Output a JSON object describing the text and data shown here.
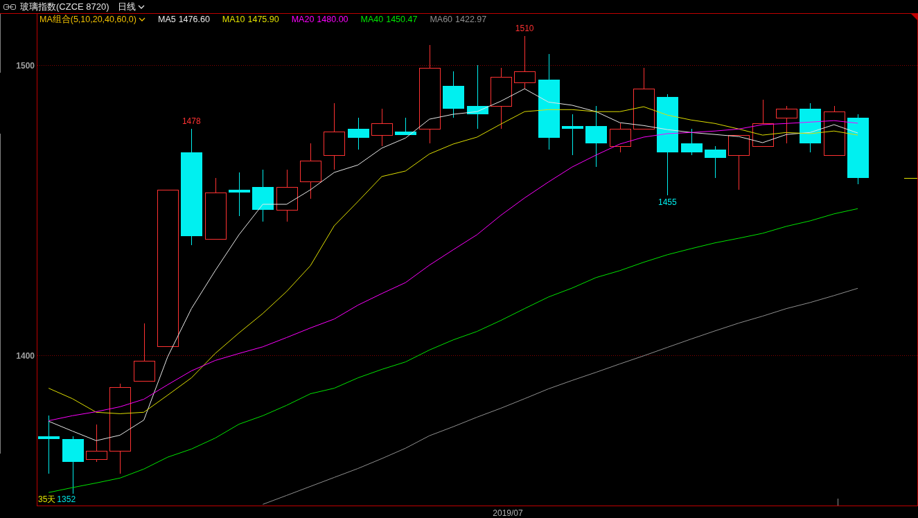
{
  "header": {
    "title": "玻璃指数(CZCE 8720)",
    "period": "日线"
  },
  "chart": {
    "legend": {
      "title": "MA组合(5,10,20,40,60,0)",
      "readings": [
        "1476.60",
        "1475.90",
        "1480.00",
        "1450.47",
        "1422.97"
      ]
    },
    "chart_data": {
      "type": "candlestick",
      "ylim": [
        1348,
        1518
      ],
      "yticks": [
        {
          "value": 1400,
          "label": "1400"
        },
        {
          "value": 1500,
          "label": "1500"
        }
      ],
      "ohlc": [
        [
          1372,
          1379,
          1359,
          1371
        ],
        [
          1371,
          1372,
          1352,
          1363
        ],
        [
          1364,
          1376,
          1363,
          1367
        ],
        [
          1367,
          1390,
          1359,
          1389
        ],
        [
          1391,
          1411,
          1391,
          1398
        ],
        [
          1403,
          1457,
          1403,
          1457
        ],
        [
          1470,
          1478,
          1438,
          1441
        ],
        [
          1440,
          1461,
          1440,
          1456
        ],
        [
          1457,
          1463,
          1448,
          1456
        ],
        [
          1458,
          1464,
          1446,
          1450
        ],
        [
          1450,
          1464,
          1446,
          1458
        ],
        [
          1460,
          1473,
          1454,
          1467
        ],
        [
          1469,
          1487,
          1464,
          1477
        ],
        [
          1478,
          1482,
          1471,
          1475
        ],
        [
          1476,
          1485,
          1472,
          1480
        ],
        [
          1477,
          1482,
          1476,
          1476
        ],
        [
          1478,
          1507,
          1473,
          1499
        ],
        [
          1493,
          1498,
          1482,
          1485
        ],
        [
          1486,
          1500,
          1478,
          1483
        ],
        [
          1486,
          1499,
          1478,
          1496
        ],
        [
          1494,
          1510,
          1492,
          1498
        ],
        [
          1495,
          1504,
          1471,
          1475
        ],
        [
          1479,
          1483,
          1469,
          1478
        ],
        [
          1479,
          1486,
          1465,
          1473
        ],
        [
          1472,
          1480,
          1470,
          1478
        ],
        [
          1478,
          1499,
          1478,
          1492
        ],
        [
          1489,
          1490,
          1455,
          1470
        ],
        [
          1473,
          1478,
          1469,
          1470
        ],
        [
          1471,
          1472,
          1461,
          1468
        ],
        [
          1469,
          1476,
          1457,
          1476
        ],
        [
          1472,
          1488,
          1472,
          1480
        ],
        [
          1482,
          1486,
          1473,
          1485
        ],
        [
          1485,
          1487,
          1470,
          1473
        ],
        [
          1469,
          1486,
          1469,
          1484
        ],
        [
          1482,
          1483,
          1459,
          1461
        ],
        null,
        null
      ],
      "series": [
        {
          "name": "MA5",
          "type": "line",
          "color": "#e8e8e8",
          "values": [
            1377.1,
            1373.7,
            1370.4,
            1372.3,
            1377.5,
            1399.3,
            1416.0,
            1429.1,
            1441.5,
            1452.0,
            1452.0,
            1457.0,
            1463.0,
            1465.6,
            1471.4,
            1474.9,
            1481.4,
            1483.1,
            1484.0,
            1487.6,
            1491.9,
            1487.3,
            1486.2,
            1484.0,
            1480.2,
            1479.2,
            1477.8,
            1476.8,
            1476.1,
            1475.4,
            1473.3,
            1476.1,
            1476.8,
            1479.5,
            1476.6,
            null,
            null
          ]
        },
        {
          "name": "MA10",
          "type": "line",
          "color": "#e0e000",
          "values": [
            1388.5,
            1384.9,
            1380.2,
            1379.7,
            1380.2,
            1386.1,
            1392.1,
            1400.5,
            1407.6,
            1414.3,
            1421.9,
            1430.8,
            1444.6,
            1453.0,
            1461.6,
            1463.5,
            1469.4,
            1472.8,
            1475.2,
            1479.7,
            1484.0,
            1484.7,
            1484.7,
            1484.0,
            1484.0,
            1485.7,
            1482.8,
            1481.1,
            1479.9,
            1478.0,
            1475.9,
            1476.8,
            1476.4,
            1477.3,
            1475.9,
            null,
            null
          ]
        },
        {
          "name": "MA20",
          "type": "line",
          "color": "#ff00ff",
          "values": [
            1377.3,
            1379.0,
            1380.4,
            1382.1,
            1384.7,
            1389.7,
            1394.5,
            1398.1,
            1400.5,
            1402.8,
            1406.0,
            1409.3,
            1412.4,
            1417.2,
            1421.2,
            1425.0,
            1431.0,
            1436.3,
            1441.5,
            1448.2,
            1454.2,
            1459.7,
            1464.9,
            1469.0,
            1472.8,
            1475.2,
            1476.4,
            1476.8,
            1477.3,
            1478.0,
            1479.5,
            1479.9,
            1480.4,
            1480.9,
            1480.0,
            null,
            null
          ]
        },
        {
          "name": "MA40",
          "type": "line",
          "color": "#00e600",
          "values": [
            1352.5,
            1354.2,
            1355.8,
            1357.5,
            1360.6,
            1364.7,
            1367.5,
            1371.3,
            1376.1,
            1379.0,
            1382.6,
            1386.6,
            1388.5,
            1392.1,
            1395.0,
            1397.6,
            1401.7,
            1405.2,
            1408.1,
            1411.9,
            1416.0,
            1420.0,
            1423.1,
            1426.7,
            1429.1,
            1432.0,
            1434.6,
            1436.7,
            1438.7,
            1440.3,
            1442.0,
            1444.4,
            1446.3,
            1448.7,
            1450.5,
            null,
            null
          ]
        },
        {
          "name": "MA60",
          "type": "line",
          "color": "#909090",
          "values": [
            null,
            null,
            null,
            null,
            null,
            null,
            null,
            null,
            null,
            1348.4,
            1351.5,
            1354.6,
            1357.7,
            1360.8,
            1364.2,
            1367.8,
            1372.1,
            1375.2,
            1378.5,
            1381.6,
            1384.9,
            1388.3,
            1391.2,
            1394.0,
            1396.9,
            1399.7,
            1402.6,
            1405.5,
            1408.3,
            1411.0,
            1413.4,
            1416.0,
            1418.1,
            1420.5,
            1423.0,
            null,
            null
          ]
        }
      ],
      "annotations": [
        "1478",
        "1510",
        "1455",
        "2019/07"
      ]
    },
    "range_summary": {
      "days": "35天",
      "low": "1352"
    }
  }
}
